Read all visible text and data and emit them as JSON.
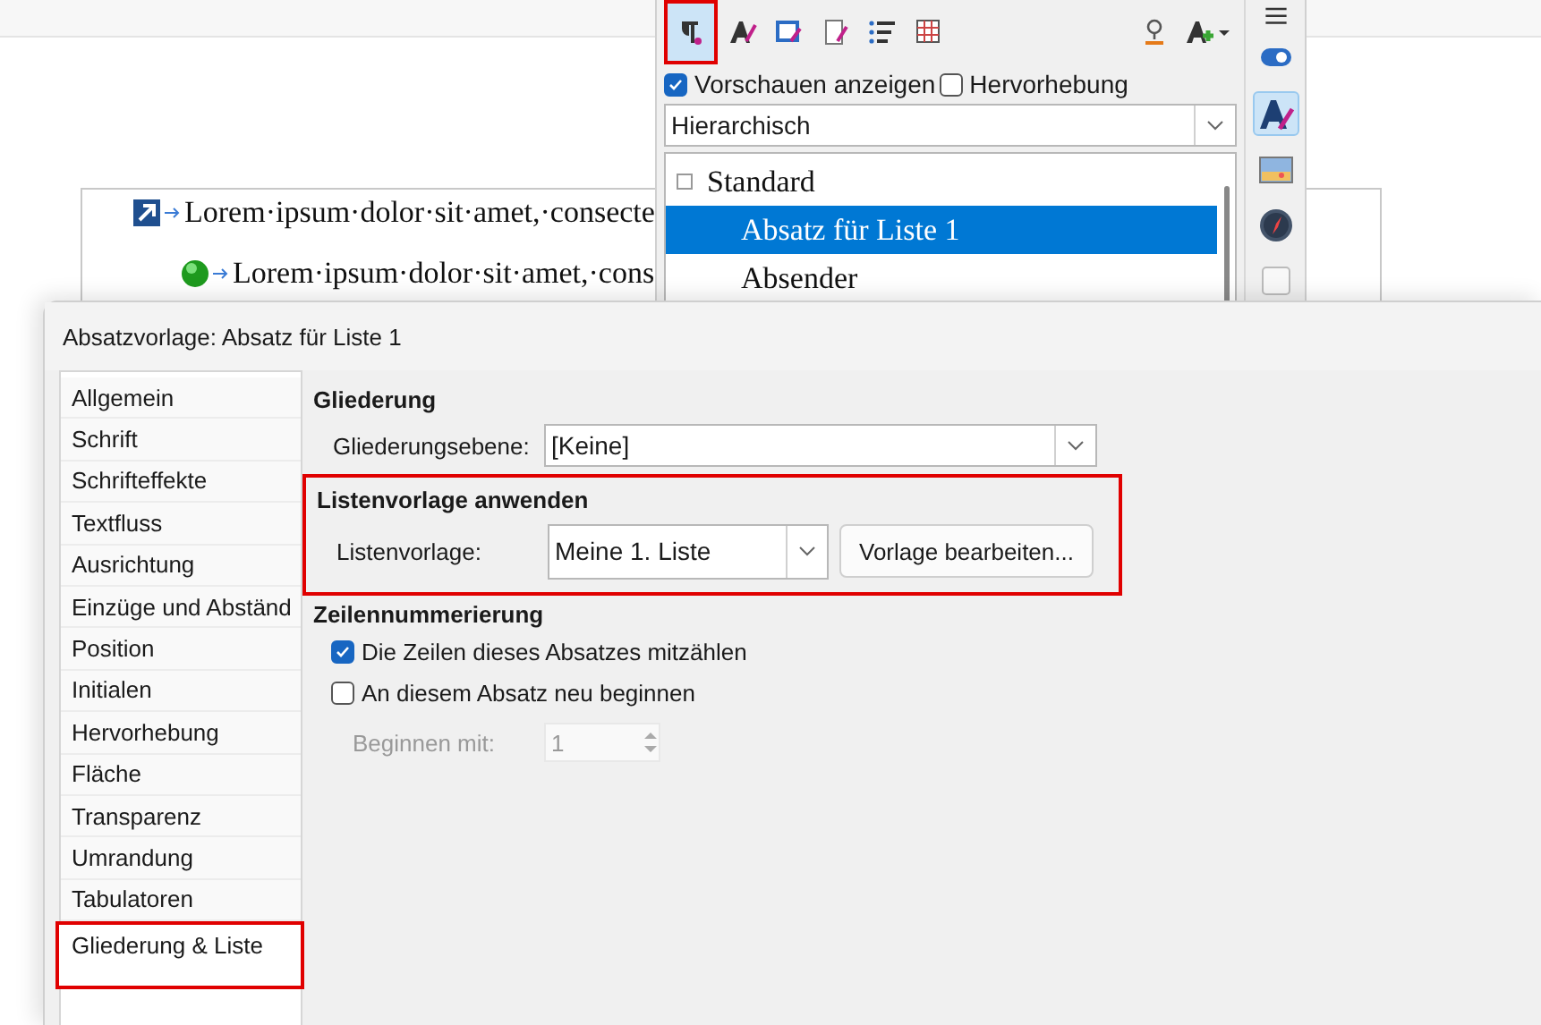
{
  "document": {
    "lines": [
      {
        "kind": "arrow-bullet",
        "text": "Lorem·ipsum·dolor·sit·amet,·consecte"
      },
      {
        "kind": "ball-bullet",
        "text": "Lorem·ipsum·dolor·sit·amet,·cons"
      }
    ]
  },
  "styles_panel": {
    "toolbar": [
      {
        "kind": "paragraph",
        "selected": true,
        "highlighted": true
      },
      {
        "kind": "character",
        "selected": false,
        "highlighted": false
      },
      {
        "kind": "frame",
        "selected": false,
        "highlighted": false
      },
      {
        "kind": "page",
        "selected": false,
        "highlighted": false
      },
      {
        "kind": "list",
        "selected": false,
        "highlighted": false
      },
      {
        "kind": "table",
        "selected": false,
        "highlighted": false
      }
    ],
    "actions": [
      {
        "kind": "fill-format"
      },
      {
        "kind": "new-style"
      }
    ],
    "checkboxes": [
      {
        "label": "Vorschauen anzeigen",
        "checked": true
      },
      {
        "label": "Hervorhebung",
        "checked": false
      }
    ],
    "filter": "Hierarchisch",
    "styles": [
      {
        "label": "Standard",
        "selected": false,
        "children": [
          {
            "label": "Absatz für Liste 1",
            "selected": true
          },
          {
            "label": "Absender",
            "selected": false
          }
        ]
      }
    ]
  },
  "deck": [
    {
      "kind": "toggle",
      "selected": false
    },
    {
      "kind": "styles",
      "selected": true
    },
    {
      "kind": "gallery",
      "selected": false
    },
    {
      "kind": "navigator",
      "selected": false
    },
    {
      "kind": "blank",
      "selected": false
    }
  ],
  "dialog": {
    "title": "Absatzvorlage: Absatz für Liste 1",
    "tabs": [
      {
        "label": "Allgemein",
        "selected": false,
        "highlighted": false
      },
      {
        "label": "Schrift",
        "selected": false,
        "highlighted": false
      },
      {
        "label": "Schrifteffekte",
        "selected": false,
        "highlighted": false
      },
      {
        "label": "Textfluss",
        "selected": false,
        "highlighted": false
      },
      {
        "label": "Ausrichtung",
        "selected": false,
        "highlighted": false
      },
      {
        "label": "Einzüge und Abständ",
        "selected": false,
        "highlighted": false
      },
      {
        "label": "Position",
        "selected": false,
        "highlighted": false
      },
      {
        "label": "Initialen",
        "selected": false,
        "highlighted": false
      },
      {
        "label": "Hervorhebung",
        "selected": false,
        "highlighted": false
      },
      {
        "label": "Fläche",
        "selected": false,
        "highlighted": false
      },
      {
        "label": "Transparenz",
        "selected": false,
        "highlighted": false
      },
      {
        "label": "Umrandung",
        "selected": false,
        "highlighted": false
      },
      {
        "label": "Tabulatoren",
        "selected": false,
        "highlighted": false
      },
      {
        "label": "Gliederung & Liste",
        "selected": true,
        "highlighted": true
      }
    ],
    "outline": {
      "heading": "Gliederung",
      "label": "Gliederungsebene:",
      "value": "[Keine]"
    },
    "list_style": {
      "heading": "Listenvorlage anwenden",
      "label": "Listenvorlage:",
      "value": "Meine 1. Liste",
      "button": "Vorlage bearbeiten...",
      "highlighted": true
    },
    "line_numbering": {
      "heading": "Zeilennummerierung",
      "checkboxes": [
        {
          "label": "Die Zeilen dieses Absatzes mitzählen",
          "checked": true
        },
        {
          "label": "An diesem Absatz neu beginnen",
          "checked": false
        }
      ],
      "start": {
        "label": "Beginnen mit:",
        "value": "1",
        "disabled": true
      }
    }
  }
}
